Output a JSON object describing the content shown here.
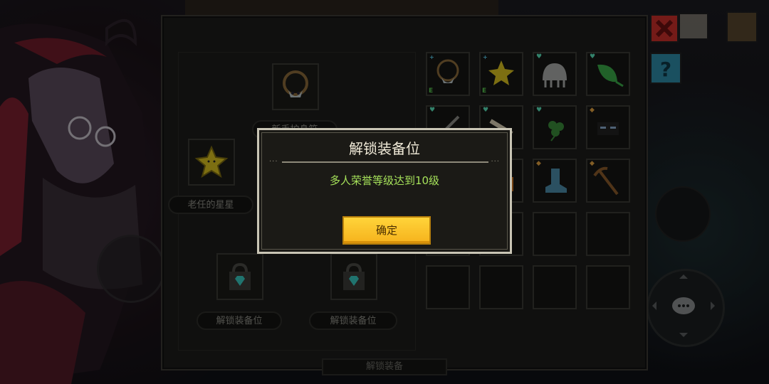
{
  "dialog": {
    "title": "解锁装备位",
    "message": "多人荣誉等级达到10级",
    "confirm_label": "确定"
  },
  "equipment": {
    "top_item_label": "新手护身符",
    "left_item_label": "老任的星星",
    "locked_slot_label": "解锁装备位",
    "bottom_label": "解锁装备"
  },
  "inventory": {
    "tags": {
      "equipped": "E"
    }
  },
  "colors": {
    "confirm_button": "#f6b21c",
    "message_text": "#a6e25a",
    "close_button": "#c8302a",
    "help_button": "#2e8aa6"
  },
  "icons": {
    "close": "close-icon",
    "help": "question-icon",
    "lock": "lock-icon",
    "chat": "chat-icon"
  }
}
